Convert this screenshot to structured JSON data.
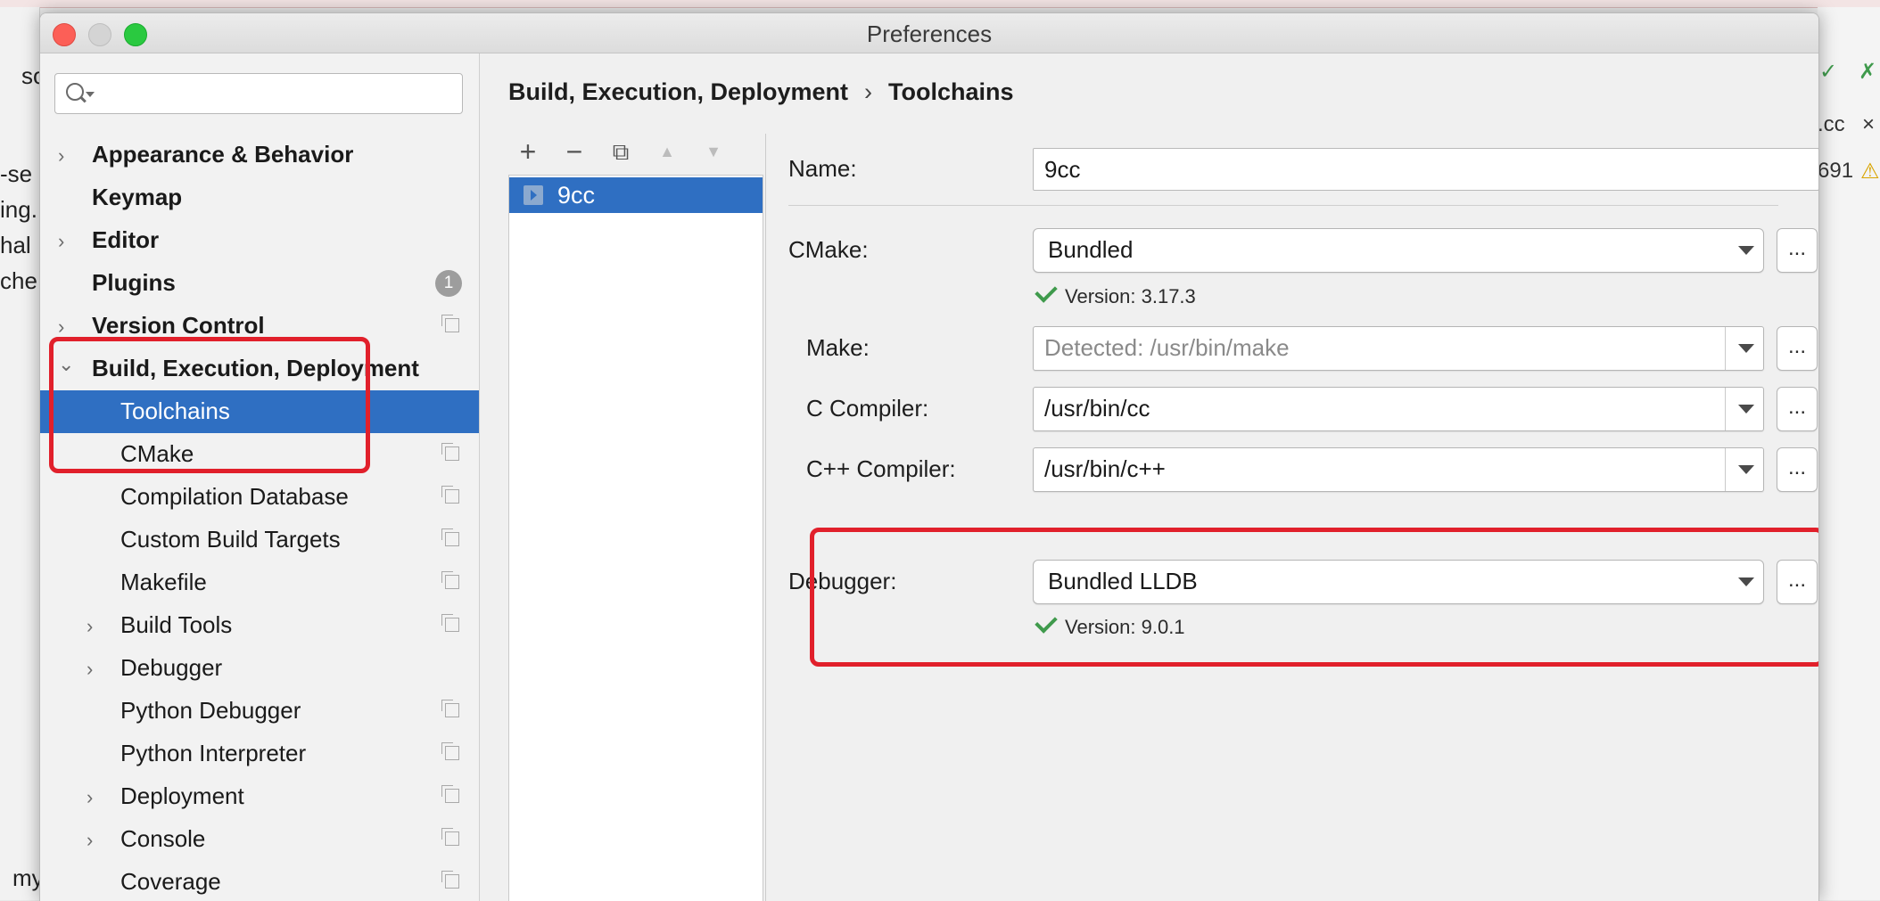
{
  "window": {
    "title": "Preferences"
  },
  "background": {
    "left_fragments": [
      "so",
      "-se",
      "ing.",
      "hal L",
      "che",
      "my"
    ],
    "right_fragments": [
      ".cc",
      "×",
      "691",
      "⚠",
      "✓",
      "✗"
    ]
  },
  "sidebar": {
    "search": {
      "placeholder": "",
      "value": ""
    },
    "items": [
      {
        "label": "Appearance & Behavior",
        "bold": true,
        "arrow": "›"
      },
      {
        "label": "Keymap",
        "bold": true
      },
      {
        "label": "Editor",
        "bold": true,
        "arrow": "›"
      },
      {
        "label": "Plugins",
        "bold": true,
        "badge": "1"
      },
      {
        "label": "Version Control",
        "bold": true,
        "arrow": "›"
      },
      {
        "label": "Build, Execution, Deployment",
        "bold": true,
        "arrow": "⌄"
      },
      {
        "label": "Toolchains",
        "selected": true
      },
      {
        "label": "CMake"
      },
      {
        "label": "Compilation Database"
      },
      {
        "label": "Custom Build Targets"
      },
      {
        "label": "Makefile"
      },
      {
        "label": "Build Tools",
        "arrow": "›"
      },
      {
        "label": "Debugger",
        "arrow": "›"
      },
      {
        "label": "Python Debugger"
      },
      {
        "label": "Python Interpreter"
      },
      {
        "label": "Deployment",
        "arrow": "›"
      },
      {
        "label": "Console",
        "arrow": "›"
      },
      {
        "label": "Coverage"
      }
    ]
  },
  "breadcrumb": {
    "parent": "Build, Execution, Deployment",
    "separator": "›",
    "current": "Toolchains"
  },
  "toolchain_list": {
    "toolbar": {
      "add": "+",
      "remove": "−",
      "copy": "⧉",
      "up": "▲",
      "down": "▼"
    },
    "items": [
      {
        "label": "9cc"
      }
    ]
  },
  "form": {
    "name": {
      "label": "Name:",
      "value": "9cc"
    },
    "cmake": {
      "label": "CMake:",
      "value": "Bundled",
      "version": "Version: 3.17.3"
    },
    "make": {
      "label": "Make:",
      "placeholder": "Detected: /usr/bin/make"
    },
    "c_compiler": {
      "label": "C Compiler:",
      "value": "/usr/bin/cc"
    },
    "cpp_compiler": {
      "label": "C++ Compiler:",
      "value": "/usr/bin/c++"
    },
    "debugger": {
      "label": "Debugger:",
      "value": "Bundled LLDB",
      "version": "Version: 9.0.1"
    },
    "browse_label": "..."
  },
  "colors": {
    "selection": "#2f6fc2",
    "highlight_box": "#e1202b",
    "check": "#3f9a4c"
  }
}
